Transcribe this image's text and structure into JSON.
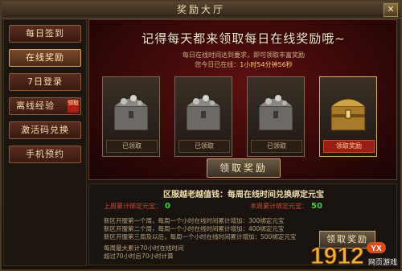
{
  "window": {
    "title": "奖励大厅",
    "close_label": "✕"
  },
  "sidebar": {
    "items": [
      {
        "label": "每日签到"
      },
      {
        "label": "在线奖励"
      },
      {
        "label": "7日登录"
      },
      {
        "label": "离线经验",
        "badge": "领取"
      },
      {
        "label": "激活码兑换"
      },
      {
        "label": "手机预约"
      }
    ]
  },
  "main": {
    "headline": "记得每天都来领取每日在线奖励哦~",
    "sub1": "每日在线时间达到要求，即可领取丰富奖励",
    "sub2_prefix": "您今日已在线：",
    "sub2_value": "1小时54分钟56秒",
    "chests": [
      {
        "status": "已领取"
      },
      {
        "status": "已领取"
      },
      {
        "status": "已领取"
      },
      {
        "status": "领取奖励"
      }
    ],
    "claim_button": "领取奖励"
  },
  "lower": {
    "title": "区服越老越值钱：每周在线时间兑换绑定元宝",
    "last_week_label": "上周累计绑定元宝：",
    "last_week_value": "0",
    "this_week_label": "本周累计绑定元宝：",
    "this_week_value": "50",
    "rules": [
      "新区开服第一个周，每周一个小时在线时间累计增加：300绑定元宝",
      "新区开服第二个周，每周一个小时在线时间累计增加：400绑定元宝",
      "新区开服第三周及以后，每周一个小时在线时间累计增加：500绑定元宝",
      "每周最大累计70小时在线时间",
      "超过70小时后70小时计算"
    ],
    "claim_button": "领取奖励"
  },
  "watermark": {
    "text": "1912",
    "badge": "YX",
    "caption": "网页游戏"
  },
  "colors": {
    "accent_gold": "#d8b360",
    "value_green": "#3fd04a",
    "label_red": "#c24b3a"
  }
}
